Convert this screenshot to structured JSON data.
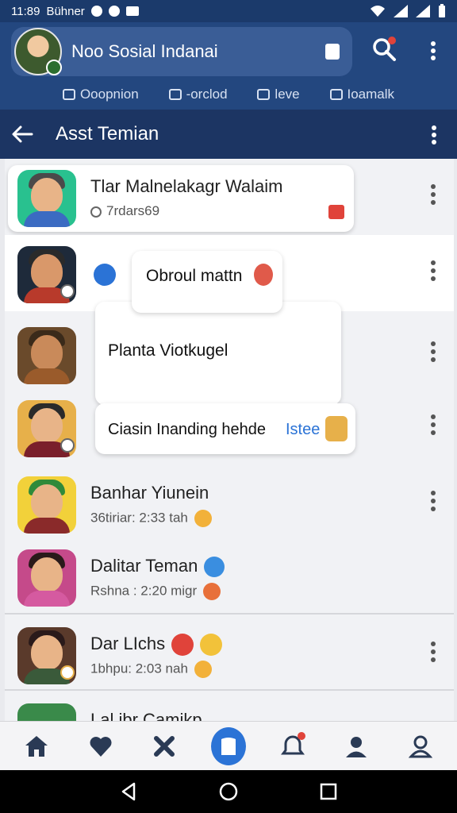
{
  "status": {
    "time": "11:89",
    "carrier": "Bühner"
  },
  "header": {
    "app_title": "Noo Sosial Indanai",
    "tabs": [
      {
        "label": "Ooopnion"
      },
      {
        "label": "-orclod"
      },
      {
        "label": "leve"
      },
      {
        "label": "Ioamalk"
      }
    ]
  },
  "subheader": {
    "title": "Asst Temian"
  },
  "contacts": [
    {
      "name": "Tlar Malnelakagr Walaim",
      "meta": "7rdars69"
    },
    {
      "name": "",
      "meta": ""
    },
    {
      "name": "",
      "meta": ""
    },
    {
      "name": "",
      "meta": ""
    },
    {
      "name": "Banhar Yiunein",
      "meta": "36tiriar: 2:33 tah"
    },
    {
      "name": "Dalitar Teman",
      "meta": "Rshna : 2:20 migr"
    },
    {
      "name": "Dar LIchs",
      "meta": "1bhpu: 2:03 nah"
    },
    {
      "name": "Lal ibr Camikp",
      "meta": ""
    }
  ],
  "popups": {
    "chat_title": "Obroul mattn",
    "item1": "Planta Viotkugel",
    "item2": "Ciasin Inanding hehde",
    "item2_link": "Istee"
  },
  "colors": {
    "status_bar": "#1b3a6b",
    "app_bar": "#23477f",
    "sub_bar": "#1c3563",
    "accent": "#2b73d6"
  }
}
